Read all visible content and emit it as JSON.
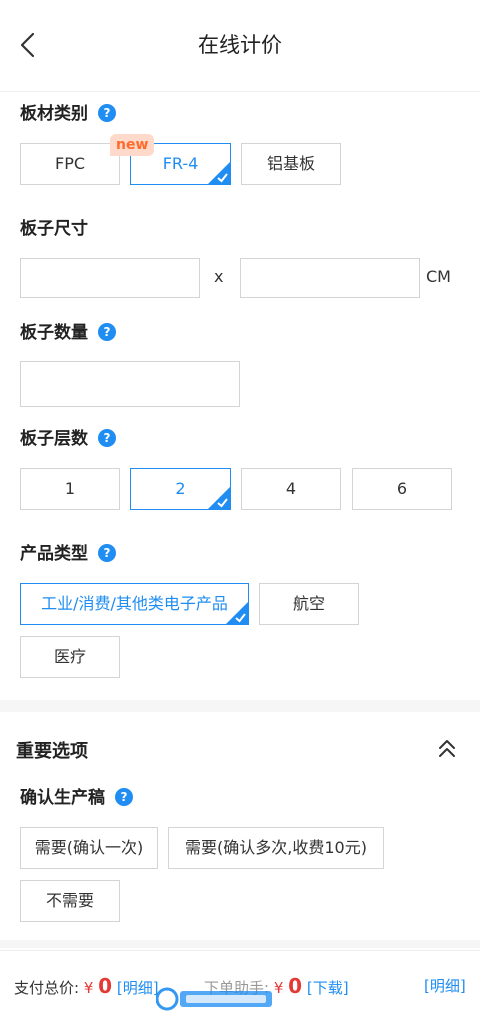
{
  "header": {
    "title": "在线计价",
    "back_icon": "chevron-left-icon"
  },
  "board_type": {
    "label": "板材类别",
    "options": [
      "FPC",
      "FR-4",
      "铝基板"
    ],
    "selected": "FR-4",
    "new_badge": "new"
  },
  "board_size": {
    "label": "板子尺寸",
    "separator": "x",
    "unit": "CM",
    "width_value": "",
    "height_value": ""
  },
  "board_qty": {
    "label": "板子数量",
    "value": ""
  },
  "layers": {
    "label": "板子层数",
    "options": [
      "1",
      "2",
      "4",
      "6"
    ],
    "selected": "2"
  },
  "product_type": {
    "label": "产品类型",
    "options": [
      "工业/消费/其他类电子产品",
      "航空",
      "医疗"
    ],
    "selected": "工业/消费/其他类电子产品"
  },
  "important": {
    "title": "重要选项",
    "collapse_icon": "double-chevron-up-icon"
  },
  "confirm_draft": {
    "label": "确认生产稿",
    "options": [
      "需要(确认一次)",
      "需要(确认多次,收费10元)",
      "不需要"
    ]
  },
  "footer": {
    "total_label": "支付总价:",
    "currency": "¥",
    "total_value": "0",
    "total_detail_link": "[明细]",
    "helper_label": "下单助手:",
    "helper_value": "0",
    "helper_download_link": "[下载]",
    "detail_link": "[明细]"
  },
  "colors": {
    "accent": "#1f8df2",
    "price": "#e53935",
    "badge_text": "#ff6b2c",
    "badge_bg": "#ffd9c9"
  }
}
